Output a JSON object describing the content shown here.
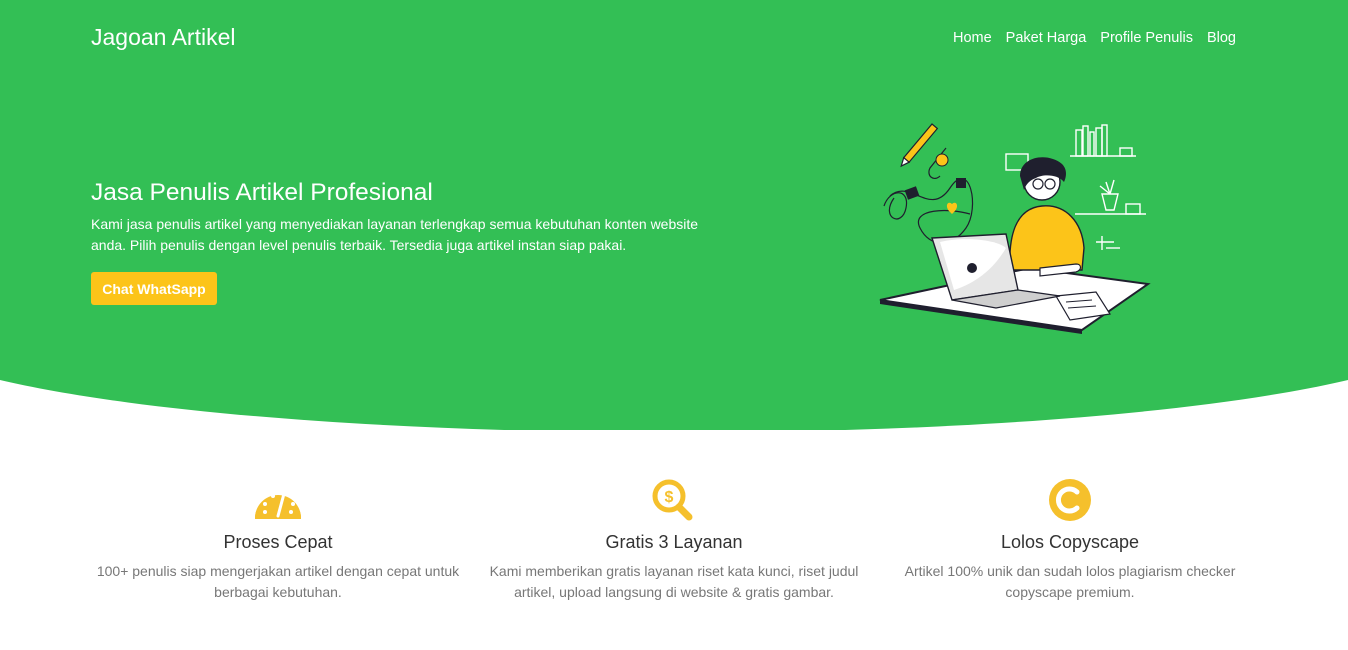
{
  "colors": {
    "primary_green": "#33bf55",
    "accent_yellow": "#fcc419",
    "text_dark": "#333333",
    "text_muted": "#777777"
  },
  "navbar": {
    "brand": "Jagoan Artikel",
    "links": [
      "Home",
      "Paket Harga",
      "Profile Penulis",
      "Blog"
    ]
  },
  "hero": {
    "title": "Jasa Penulis Artikel Profesional",
    "description": "Kami jasa penulis artikel yang menyediakan layanan terlengkap semua kebutuhan konten website anda. Pilih penulis dengan level penulis terbaik. Tersedia juga artikel instan siap pakai.",
    "cta_label": "Chat WhatSapp",
    "illustration": "person-writing-on-laptop-illustration"
  },
  "features": [
    {
      "icon": "speedometer-icon",
      "title": "Proses Cepat",
      "text": "100+ penulis siap mengerjakan artikel dengan cepat untuk berbagai kebutuhan."
    },
    {
      "icon": "dollar-search-icon",
      "title": "Gratis 3 Layanan",
      "text": "Kami memberikan gratis layanan riset kata kunci, riset judul artikel, upload langsung di website & gratis gambar."
    },
    {
      "icon": "copyright-icon",
      "title": "Lolos Copyscape",
      "text": "Artikel 100% unik dan sudah lolos plagiarism checker copyscape premium."
    }
  ]
}
